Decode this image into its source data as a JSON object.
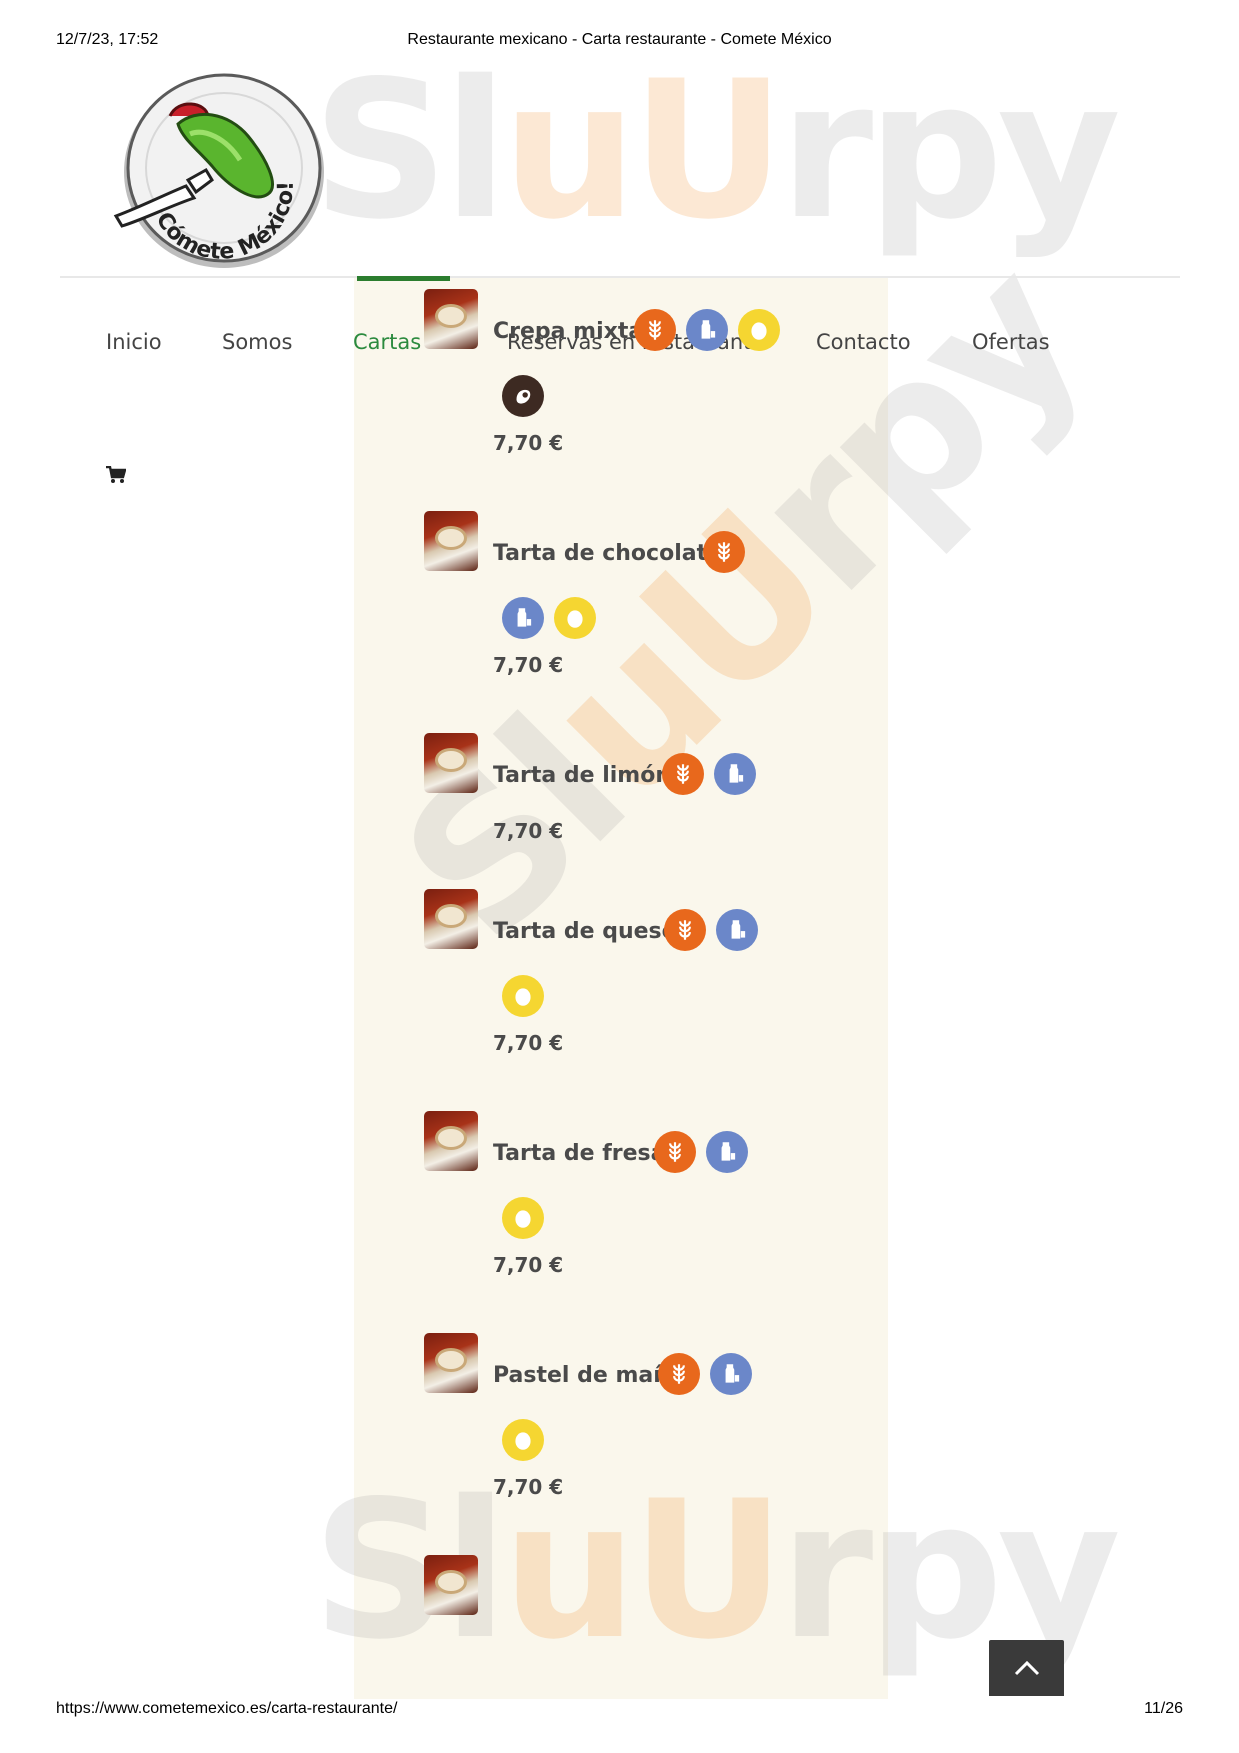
{
  "print": {
    "datetime": "12/7/23, 17:52",
    "title": "Restaurante mexicano - Carta restaurante - Comete México",
    "url": "https://www.cometemexico.es/carta-restaurante/",
    "page": "11/26"
  },
  "logo": {
    "text": "Cómete México!"
  },
  "watermark": {
    "text_pre": "Sl",
    "text_u": "uU",
    "text_post": "rpy"
  },
  "nav": {
    "items": [
      {
        "label": "Inicio"
      },
      {
        "label": "Somos"
      },
      {
        "label": "Cartas",
        "active": true
      },
      {
        "label": "Reservas en restaurante"
      },
      {
        "label": "Contacto"
      },
      {
        "label": "Ofertas"
      }
    ]
  },
  "menu": {
    "items": [
      {
        "name": "Crepa mixta",
        "price": "7,70 €",
        "allergens": [
          "gluten",
          "milk",
          "egg",
          "nuts"
        ]
      },
      {
        "name": "Tarta de chocolate",
        "price": "7,70 €",
        "allergens": [
          "gluten",
          "milk",
          "egg"
        ]
      },
      {
        "name": "Tarta de limón",
        "price": "7,70 €",
        "allergens": [
          "gluten",
          "milk"
        ]
      },
      {
        "name": "Tarta de queso",
        "price": "7,70 €",
        "allergens": [
          "gluten",
          "milk",
          "egg"
        ]
      },
      {
        "name": "Tarta de fresa",
        "price": "7,70 €",
        "allergens": [
          "gluten",
          "milk",
          "egg"
        ]
      },
      {
        "name": "Pastel de maíz",
        "price": "7,70 €",
        "allergens": [
          "gluten",
          "milk",
          "egg"
        ]
      }
    ]
  },
  "colors": {
    "active_nav": "#2b8a3e",
    "gluten": "#e8681c",
    "milk": "#6b87c9",
    "egg": "#f5d631",
    "nuts": "#3d2a22",
    "panel": "#faf7ec"
  },
  "icons": {
    "gluten": "wheat-icon",
    "milk": "milk-icon",
    "egg": "egg-icon",
    "nuts": "nut-icon",
    "cart": "cart-icon",
    "back_top": "chevron-up-icon"
  }
}
